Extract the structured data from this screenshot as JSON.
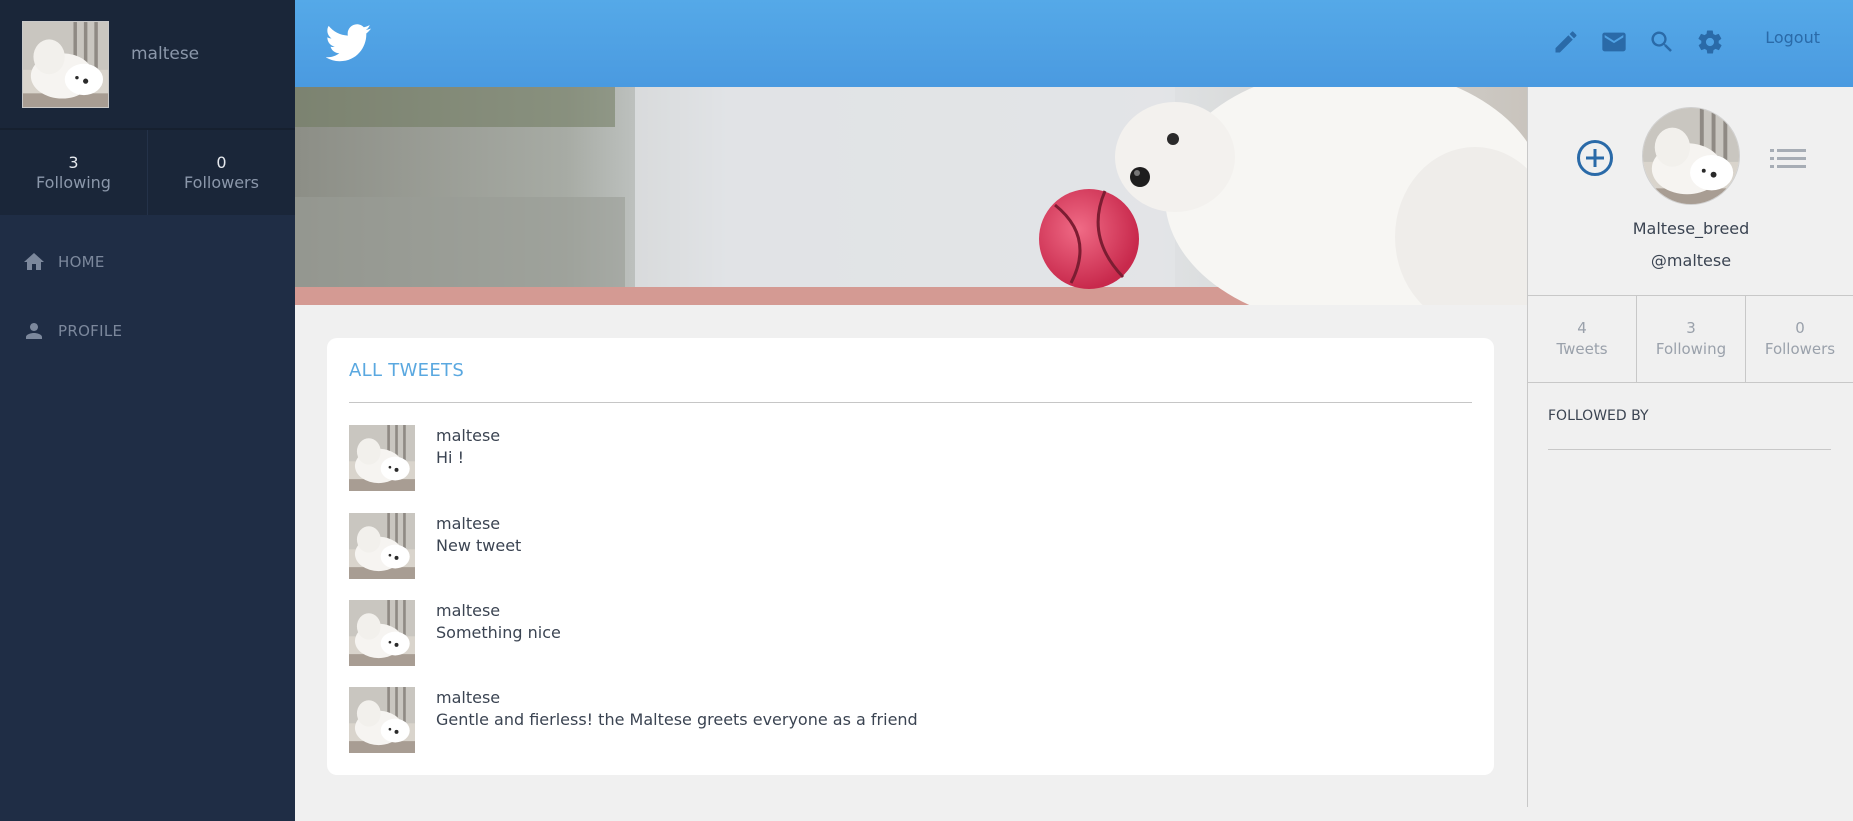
{
  "sidebar": {
    "username": "maltese",
    "stats": [
      {
        "count": "3",
        "label": "Following"
      },
      {
        "count": "0",
        "label": "Followers"
      }
    ],
    "nav": [
      {
        "label": "HOME",
        "icon": "home-icon"
      },
      {
        "label": "PROFILE",
        "icon": "person-icon"
      }
    ]
  },
  "topbar": {
    "logo": "twitter-bird-icon",
    "icons": [
      "pencil-icon",
      "mail-icon",
      "search-icon",
      "gear-icon"
    ],
    "logout_label": "Logout"
  },
  "feed": {
    "title": "ALL TWEETS",
    "tweets": [
      {
        "user": "maltese",
        "text": "Hi !"
      },
      {
        "user": "maltese",
        "text": "New tweet"
      },
      {
        "user": "maltese",
        "text": "Something nice"
      },
      {
        "user": "maltese",
        "text": "Gentle and fierless! the Maltese greets everyone as a friend"
      }
    ]
  },
  "profile": {
    "name": "Maltese_breed",
    "handle": "@maltese",
    "stats": [
      {
        "count": "4",
        "label": "Tweets"
      },
      {
        "count": "3",
        "label": "Following"
      },
      {
        "count": "0",
        "label": "Followers"
      }
    ],
    "followed_by_title": "FOLLOWED BY"
  },
  "colors": {
    "sidebar_bg": "#1f2d45",
    "topbar_bg": "#4fa3e6",
    "accent": "#5aa8e0",
    "add_button": "#2a6aa8"
  }
}
